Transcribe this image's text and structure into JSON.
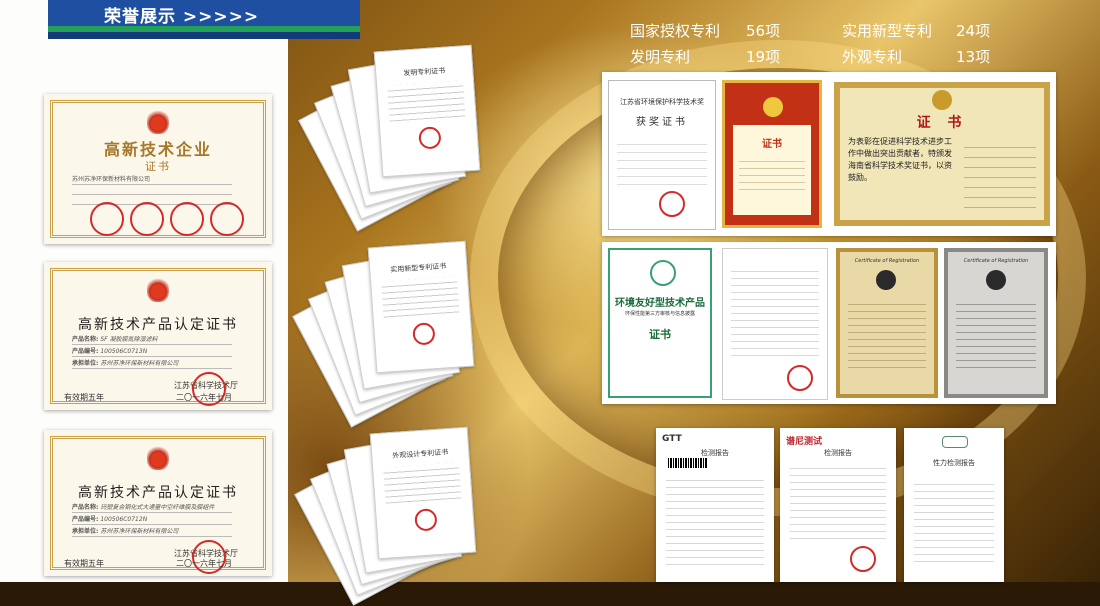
{
  "header": {
    "title": "荣誉展示 >>>>>"
  },
  "stats": [
    {
      "label": "国家授权专利",
      "value": "56项"
    },
    {
      "label": "实用新型专利",
      "value": "24项"
    },
    {
      "label": "发明专利",
      "value": "19项"
    },
    {
      "label": "外观专利",
      "value": "13项"
    }
  ],
  "left_certs": [
    {
      "title": "高新技术企业",
      "subtitle": "证书",
      "company": "苏州苏净环保新材料有限公司",
      "date": ""
    },
    {
      "title": "高新技术产品认定证书",
      "product_label": "产品名称:",
      "product": "SF 凝胶膜氮除湿滤料",
      "no_label": "产品编号:",
      "no": "100506C0713N",
      "owner_label": "承担单位:",
      "owner": "苏州苏净环保新材料有限公司",
      "issuer": "江苏省科学技术厅",
      "date": "二〇一六年七月",
      "valid": "有效期五年"
    },
    {
      "title": "高新技术产品认定证书",
      "product_label": "产品名称:",
      "product": "玛塑复合钢化式大通量中空纤维膜及膜组件",
      "no_label": "产品编号:",
      "no": "100506C0712N",
      "owner_label": "承担单位:",
      "owner": "苏州苏净环保新材料有限公司",
      "issuer": "江苏省科学技术厅",
      "date": "二〇一六年七月",
      "valid": "有效期五年"
    }
  ],
  "patent_stacks": [
    {
      "title": "发明专利证书"
    },
    {
      "title": "实用新型专利证书"
    },
    {
      "title": "外观设计专利证书"
    }
  ],
  "award_panel": {
    "c1": {
      "org": "江苏省环境保护科学技术奖",
      "title": "获奖证书"
    },
    "c2": {
      "title": "证书"
    },
    "c3": {
      "title": "证 书",
      "body": "为表彰在促进科学技术进步工作中做出突出贡献者，特颁发海南省科学技术奖证书，以资鼓励。"
    }
  },
  "env_panel": {
    "c1": {
      "title": "环境友好型技术产品",
      "subtitle": "环保性能第三方审核与信息披露",
      "tag": "证书"
    },
    "c3": {
      "title": "Certificate of Registration"
    },
    "c4": {
      "title": "Certificate of Registration"
    }
  },
  "reports": [
    {
      "brand": "GTT",
      "title": "检测报告"
    },
    {
      "brand": "谱尼测试",
      "title": "检测报告"
    },
    {
      "brand": "",
      "title": "性力检测报告"
    }
  ]
}
